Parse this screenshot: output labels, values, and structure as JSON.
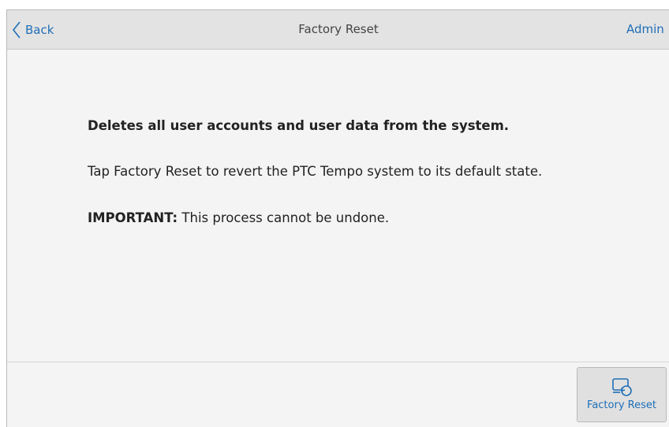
{
  "header": {
    "back_label": "Back",
    "title": "Factory Reset",
    "admin_label": "Admin"
  },
  "main": {
    "line1": "Deletes all user accounts and user data from the system.",
    "line2": "Tap Factory Reset to revert the PTC Tempo system to its default state.",
    "important_label": "IMPORTANT:",
    "important_text": " This process cannot be undone."
  },
  "footer": {
    "factory_reset_label": "Factory Reset"
  },
  "icons": {
    "back": "chevron-left-icon",
    "factory_reset": "device-reset-icon"
  },
  "colors": {
    "accent": "#1f6fb6",
    "header_bg": "#e3e3e3",
    "page_bg": "#f4f4f4",
    "button_bg": "#e0e0e0"
  }
}
